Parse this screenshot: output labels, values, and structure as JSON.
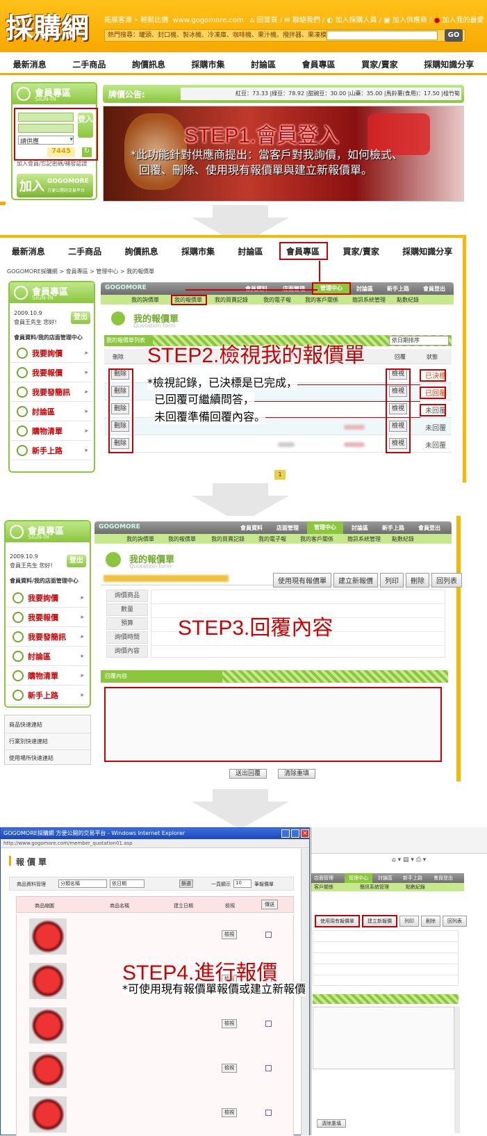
{
  "site": {
    "logo": "採購網",
    "slogan": "拓展客源 • 輕鬆比價",
    "url": "www.gogomore.com",
    "toplinks": [
      "回首頁",
      "聯絡我們",
      "加入採購人員",
      "加入供應商",
      "加入我的最愛"
    ],
    "hot_label": "熱門搜尋：",
    "hot_items": "罐頭、封口機、製冰機、冷凍庫、咖啡機、果汁機、攪拌器、果凍模",
    "go": "GO"
  },
  "nav": [
    "最新消息",
    "二手商品",
    "詢價訊息",
    "採購市集",
    "討論區",
    "會員專區",
    "買家/賣家",
    "採購知識分享"
  ],
  "step1": {
    "member_title": "會員專區",
    "member_sub": "SIGN-IN",
    "login_btn": "登入",
    "select": "請供應",
    "captcha": "7445",
    "links": "加入會員/忘記密碼/補發認證",
    "join": "加入",
    "brand": "GOGOMORE",
    "brand_sub": "方便公開的交易平台",
    "price_label": "牌價公告:",
    "price_ticker": "紅豆：73.33 |綠豆：78.92 |甜豌豆：30.00 |山藥：35.00 |馬鈴薯(食用)：17.50 |桂竹筍",
    "title": "STEP1.會員登入",
    "note1": "*此功能針對供應商提出：當客戶對我詢價，如何檢式、",
    "note2": "回覆、刪除、使用現有報價單與建立新報價單。"
  },
  "step2": {
    "breadcrumb": "GOGOMORE採購網 > 會員專區 > 管理中心 > 我的報價單",
    "brand": "GOGOMORE",
    "topmenu": [
      "會員資料",
      "店面管理",
      "管理中心",
      "討論區",
      "新手上路",
      "會員登出"
    ],
    "submenu": [
      "我的詢價單",
      "我的報價單",
      "我的買賣記錄",
      "我的電子報",
      "我的客戶關係",
      "簡訊系統管理",
      "點數紀錄"
    ],
    "date": "2009.10.9",
    "greeting": "會員王先生 您好!",
    "logout": "登出",
    "side_head": "會員資料/我的店面管理中心",
    "side": [
      "我要詢價",
      "我要報價",
      "我要發簡訊",
      "討論區",
      "購物清單",
      "新手上路"
    ],
    "page_title": "我的報價單",
    "page_sub": "Quotation form",
    "list_label": "我的報價單列表",
    "sort": "依日期排序",
    "cols": [
      "刪除",
      "回覆",
      "狀態"
    ],
    "del": "刪除",
    "view": "檢視",
    "status": [
      "已決標",
      "已回覆",
      "未回覆",
      "未回覆",
      "未回覆"
    ],
    "page_num": "1",
    "title": "STEP2.檢視我的報價單",
    "note1": "*檢視記錄，已決標是已完成，",
    "note2": "已回覆可繼續問答，",
    "note3": "未回覆準備回覆內容。"
  },
  "step3": {
    "actions": [
      "使用現有報價單",
      "建立新報價",
      "列印",
      "刪除",
      "回列表"
    ],
    "fields": [
      "詢價商品",
      "數量",
      "預算",
      "詢價時間",
      "詢價內容"
    ],
    "reply_label": "回覆內容",
    "submit": "送出回覆",
    "reset": "清除重填",
    "quick": [
      "商品快速連結",
      "行業別快速連結",
      "使用場所快速連結"
    ],
    "title": "STEP3.回覆內容"
  },
  "step4": {
    "ie_title": "GOGOMORE採購網 方便公開的交易平台 - Windows Internet Explorer",
    "address": "http://www.gogomore.com/member_quotation01.asp",
    "page_title": "報價單",
    "filter_label": "商品資料管理",
    "sel1": "分類名稱",
    "sel2": "依日期",
    "filter_btn": "篩選",
    "per_page": "一頁顯示",
    "per_num": "10",
    "per_unit": "筆報價單",
    "cols": [
      "商品縮圖",
      "商品名稱",
      "建立日期",
      "檢視",
      "傳送"
    ],
    "view": "檢視",
    "right_actions": [
      "使用現有報價單",
      "建立新報價",
      "列印",
      "刪除",
      "回列表"
    ],
    "right_menu": [
      "店面管理",
      "管理中心",
      "討論區",
      "新手上路",
      "會員登出"
    ],
    "right_sub": [
      "客戶關係",
      "簡訊系統管理",
      "點數紀錄"
    ],
    "reset": "清除重填",
    "title": "STEP4.進行報價",
    "note": "*可使用現有報價單報價或建立新報價"
  }
}
